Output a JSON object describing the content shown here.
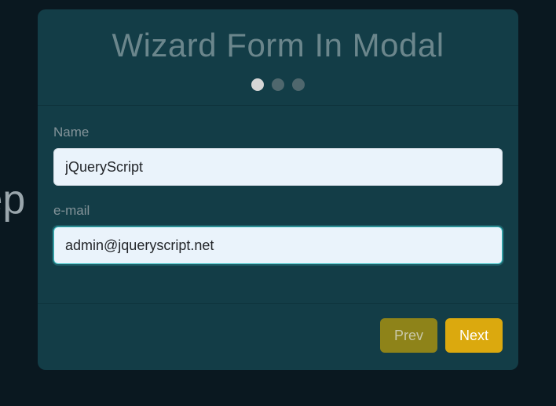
{
  "background_text": "tep",
  "modal": {
    "title": "Wizard Form In Modal",
    "steps": {
      "total": 3,
      "active_index": 0
    },
    "form": {
      "name": {
        "label": "Name",
        "value": "jQueryScript"
      },
      "email": {
        "label": "e-mail",
        "value": "admin@jqueryscript.net"
      }
    },
    "footer": {
      "prev_label": "Prev",
      "next_label": "Next"
    }
  },
  "colors": {
    "modal_bg": "#133d47",
    "page_bg": "#0a1820",
    "accent": "#dba90e",
    "accent_muted": "#8e8319"
  }
}
